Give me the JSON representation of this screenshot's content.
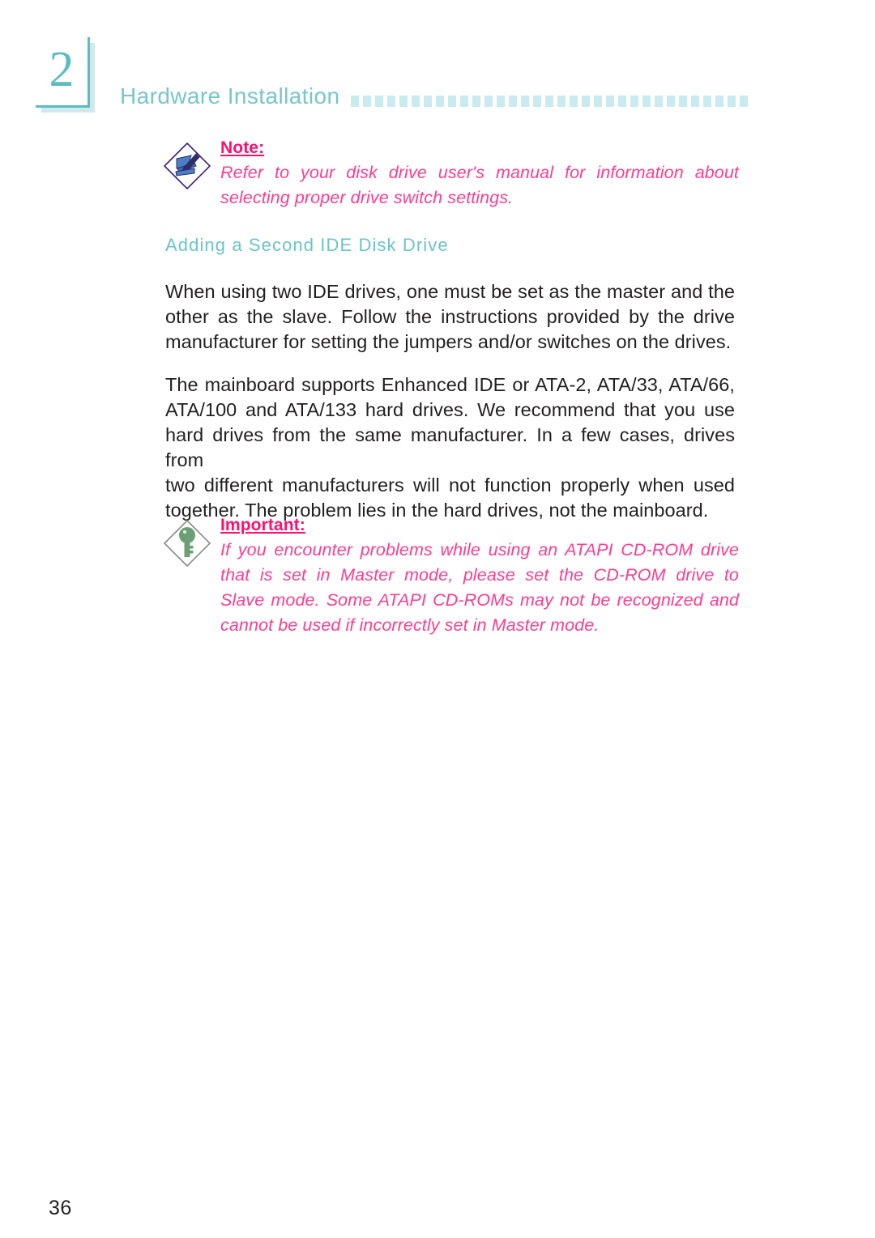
{
  "page": {
    "chapter_number": "2",
    "header_title": "Hardware Installation",
    "page_number": "36",
    "dot_count": 33,
    "colors": {
      "teal": "#5bbcc4",
      "teal_light": "#76c6cc",
      "dot": "#c9ebef",
      "pink_title": "#ff0f6e",
      "pink_text": "#ff3d8f",
      "body": "#231f20",
      "heading": "#6cc3ca",
      "note_diamond": "#3b1f7a",
      "note_fill": "#4b7fc4",
      "key_diamond": "#8a8a8a",
      "key_fill": "#6d9f74"
    }
  },
  "note": {
    "icon": "note-pen-diamond-icon",
    "title": "Note:",
    "lines": [
      "Refer to your disk drive user's manual for information about",
      "selecting proper drive switch settings."
    ]
  },
  "section": {
    "heading": "Adding a Second IDE Disk Drive"
  },
  "paragraphs": {
    "p1": [
      "When using two IDE drives, one must be set as the master and the",
      "other as the slave. Follow the instructions provided by the drive",
      "manufacturer for setting the jumpers and/or switches on the drives."
    ],
    "p2": [
      "The mainboard supports Enhanced IDE or ATA-2, ATA/33, ATA/66,",
      "ATA/100 and ATA/133 hard drives. We recommend that you use",
      "hard drives from the same manufacturer. In a few cases, drives from",
      "two different manufacturers will not function properly when used",
      "together. The problem lies in the hard drives, not the mainboard."
    ]
  },
  "important": {
    "icon": "key-diamond-icon",
    "title": "Important:",
    "lines": [
      "If you encounter problems while using an ATAPI CD-ROM drive",
      "that is set in Master mode, please set the CD-ROM drive to",
      "Slave mode. Some ATAPI CD-ROMs may not be recognized and",
      "cannot be used if incorrectly set in Master mode."
    ]
  }
}
